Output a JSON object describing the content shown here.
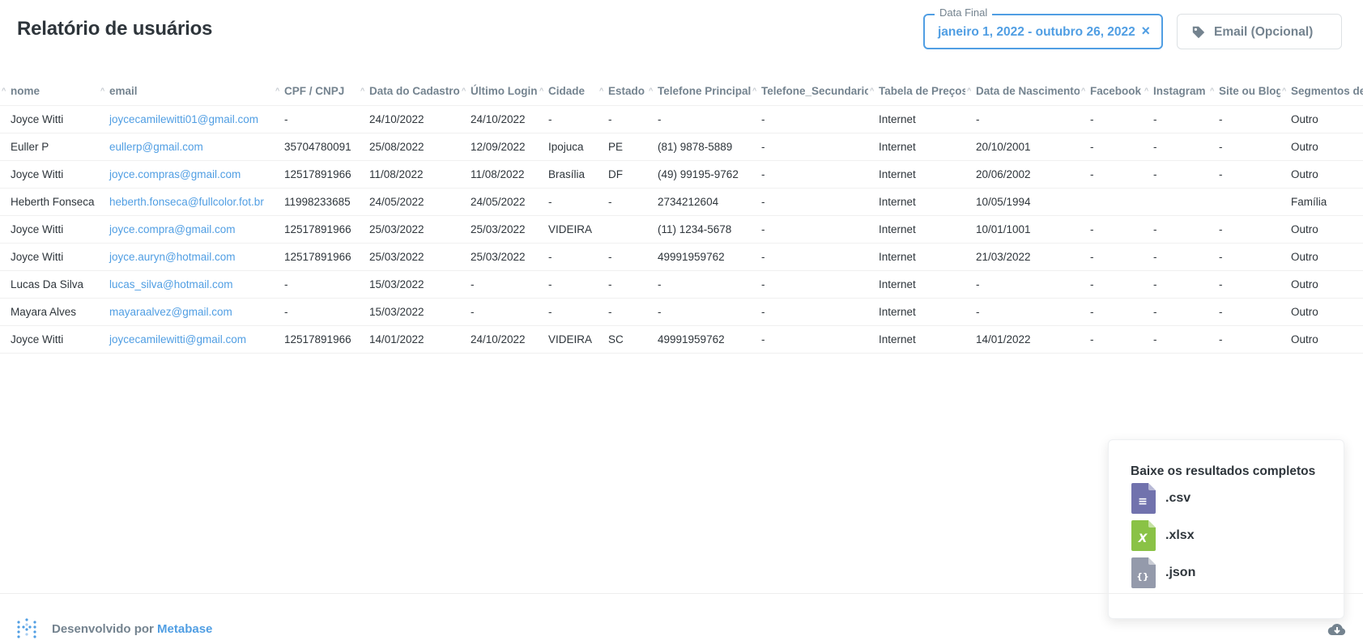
{
  "header": {
    "title": "Relatório de usuários",
    "date_filter": {
      "legend": "Data Final",
      "value": "janeiro 1, 2022 - outubro 26, 2022",
      "clear": "×"
    },
    "email_filter": {
      "placeholder": "Email (Opcional)"
    }
  },
  "table": {
    "columns": [
      "nome",
      "email",
      "CPF / CNPJ",
      "Data do Cadastro",
      "Último Login",
      "Cidade",
      "Estado",
      "Telefone Principal",
      "Telefone_Secundario",
      "Tabela de Preços",
      "Data de Nascimento",
      "Facebook",
      "Instagram",
      "Site ou Blog",
      "Segmentos de A"
    ],
    "rows": [
      [
        "Joyce Witti",
        "joycecamilewitti01@gmail.com",
        "-",
        "24/10/2022",
        "24/10/2022",
        "-",
        "-",
        "-",
        "-",
        "Internet",
        "-",
        "-",
        "-",
        "-",
        "Outro"
      ],
      [
        "Euller P",
        "eullerp@gmail.com",
        "35704780091",
        "25/08/2022",
        "12/09/2022",
        "Ipojuca",
        "PE",
        "(81) 9878-5889",
        "-",
        "Internet",
        "20/10/2001",
        "-",
        "-",
        "-",
        "Outro"
      ],
      [
        "Joyce Witti",
        "joyce.compras@gmail.com",
        "12517891966",
        "11/08/2022",
        "11/08/2022",
        "Brasília",
        "DF",
        "(49) 99195-9762",
        "-",
        "Internet",
        "20/06/2002",
        "-",
        "-",
        "-",
        "Outro"
      ],
      [
        "Heberth Fonseca",
        "heberth.fonseca@fullcolor.fot.br",
        "11998233685",
        "24/05/2022",
        "24/05/2022",
        "-",
        "-",
        "2734212604",
        "-",
        "Internet",
        "10/05/1994",
        "",
        "",
        "",
        "Família"
      ],
      [
        "Joyce Witti",
        "joyce.compra@gmail.com",
        "12517891966",
        "25/03/2022",
        "25/03/2022",
        "VIDEIRA",
        "",
        "(11) 1234-5678",
        "-",
        "Internet",
        "10/01/1001",
        "-",
        "-",
        "-",
        "Outro"
      ],
      [
        "Joyce Witti",
        "joyce.auryn@hotmail.com",
        "12517891966",
        "25/03/2022",
        "25/03/2022",
        "-",
        "-",
        "49991959762",
        "-",
        "Internet",
        "21/03/2022",
        "-",
        "-",
        "-",
        "Outro"
      ],
      [
        "Lucas Da Silva",
        "lucas_silva@hotmail.com",
        "-",
        "15/03/2022",
        "-",
        "-",
        "-",
        "-",
        "-",
        "Internet",
        "-",
        "-",
        "-",
        "-",
        "Outro"
      ],
      [
        "Mayara Alves",
        "mayaraalvez@gmail.com",
        "-",
        "15/03/2022",
        "-",
        "-",
        "-",
        "-",
        "-",
        "Internet",
        "-",
        "-",
        "-",
        "-",
        "Outro"
      ],
      [
        "Joyce Witti",
        "joycecamilewitti@gmail.com",
        "12517891966",
        "14/01/2022",
        "24/10/2022",
        "VIDEIRA",
        "SC",
        "49991959762",
        "-",
        "Internet",
        "14/01/2022",
        "-",
        "-",
        "-",
        "Outro"
      ]
    ]
  },
  "download_panel": {
    "title": "Baixe os resultados completos",
    "formats": [
      {
        "ext": ".csv",
        "icon": "csv-file-icon",
        "color": "#7172ad",
        "glyph": "≡"
      },
      {
        "ext": ".xlsx",
        "icon": "xlsx-file-icon",
        "color": "#8ac246",
        "glyph": "X"
      },
      {
        "ext": ".json",
        "icon": "json-file-icon",
        "color": "#949aab",
        "glyph": "{}"
      }
    ]
  },
  "footer": {
    "powered_prefix": "Desenvolvido por",
    "brand": "Metabase"
  },
  "colors": {
    "accent": "#509ee3",
    "text": "#2e353b",
    "muted": "#74838f"
  }
}
